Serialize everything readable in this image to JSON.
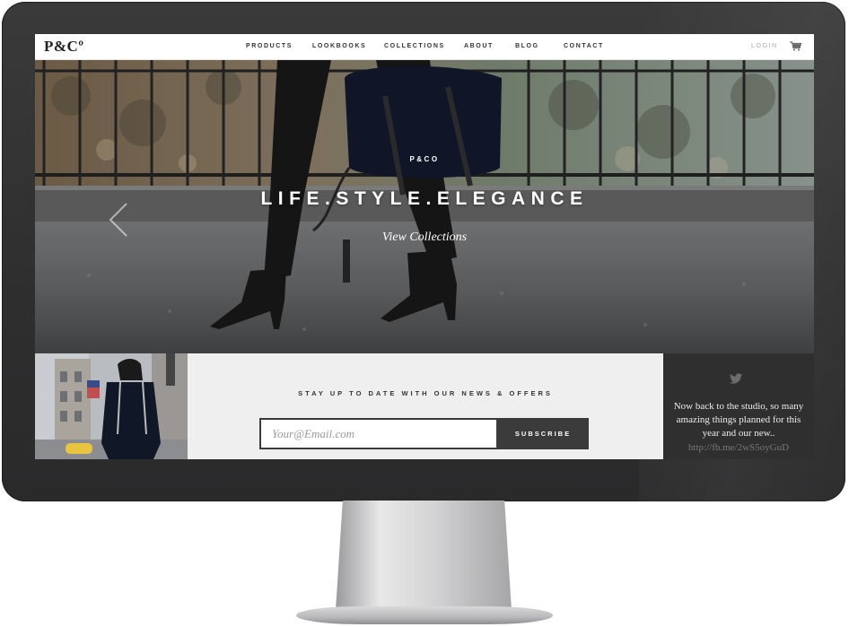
{
  "nav": {
    "logo": "P&Cº",
    "links": [
      "PRODUCTS",
      "LOOKBOOKS",
      "COLLECTIONS",
      "ABOUT",
      "BLOG",
      "CONTACT"
    ],
    "login": "LOGIN",
    "cart_icon": "cart-icon"
  },
  "hero": {
    "brand": "P&CO",
    "title": "LIFE.STYLE.ELEGANCE",
    "link": "View Collections",
    "prev_icon": "chevron-left-icon"
  },
  "newsletter": {
    "heading": "STAY UP TO DATE WITH OUR NEWS & OFFERS",
    "email_placeholder": "Your@Email.com",
    "button": "SUBSCRIBE"
  },
  "twitter": {
    "icon": "twitter-icon",
    "tweet": "Now back to the studio, so many amazing things planned for this year and our new..",
    "link": "http://fb.me/2wS5oyGuD"
  },
  "colors": {
    "monitor_bezel": "#2f2f30",
    "newsletter_bg": "#efefef",
    "twitter_bg": "#2f2f30",
    "button_bg": "#3b3b3c"
  }
}
